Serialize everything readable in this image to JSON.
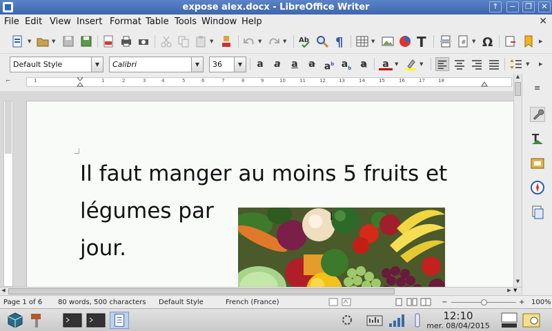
{
  "window": {
    "title": "expose alex.docx - LibreOffice Writer",
    "controls": [
      "↑",
      "−",
      "❐",
      "✕"
    ]
  },
  "menubar": {
    "items": [
      "File",
      "Edit",
      "View",
      "Insert",
      "Format",
      "Table",
      "Tools",
      "Window",
      "Help"
    ],
    "close_doc": "✕"
  },
  "formatting": {
    "paragraph_style": "Default Style",
    "font_name": "Calibri",
    "font_size": "36"
  },
  "ruler": {
    "labels": [
      "1",
      "1",
      "2",
      "3",
      "4",
      "5",
      "6",
      "7",
      "8",
      "9",
      "10",
      "11",
      "12",
      "13",
      "14",
      "15",
      "16",
      "17",
      "18"
    ]
  },
  "document": {
    "text": "Il faut manger au moins 5 fruits et légumes par\njour."
  },
  "statusbar": {
    "page": "Page 1 of 6",
    "word_count": "80 words, 500 characters",
    "page_style": "Default Style",
    "language": "French (France)",
    "zoom": "100%"
  },
  "taskbar": {
    "time": "12:10",
    "date": "mer. 08/04/2015"
  },
  "colors": {
    "titlebar": "#3d66ad",
    "font_color": "#c00000",
    "highlight": "#ffff00"
  }
}
